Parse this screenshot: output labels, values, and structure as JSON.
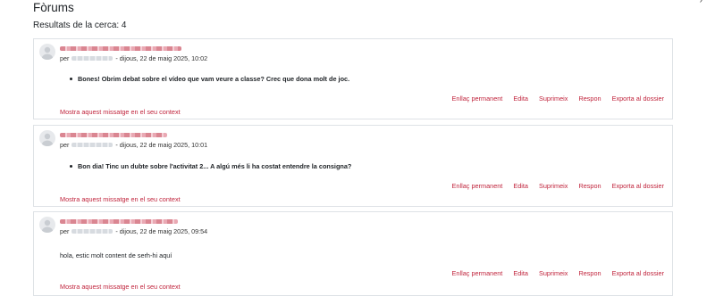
{
  "page": {
    "title": "Fòrums",
    "results_label": "Resultats de la cerca: 4",
    "corner_glyph": "›"
  },
  "colors": {
    "link": "#c0243c",
    "border": "#dee2e6",
    "text": "#1d2125"
  },
  "posts": [
    {
      "subject": "",
      "author": "",
      "by_prefix": "per",
      "date": "- dijous, 22 de maig 2025, 10:02",
      "message": "Bones! Obrim debat sobre el vídeo que vam veure a classe? Crec que dona molt de joc.",
      "message_is_bullet": true,
      "commands": [
        "Enllaç permanent",
        "Edita",
        "Suprimeix",
        "Respon",
        "Exporta al dossier"
      ],
      "context_link": "Mostra aquest missatge en el seu context"
    },
    {
      "subject": "",
      "author": "",
      "by_prefix": "per",
      "date": "- dijous, 22 de maig 2025, 10:01",
      "message": "Bon dia! Tinc un dubte sobre l'activitat 2... A algú més li ha costat entendre la consigna?",
      "message_is_bullet": true,
      "commands": [
        "Enllaç permanent",
        "Edita",
        "Suprimeix",
        "Respon",
        "Exporta al dossier"
      ],
      "context_link": "Mostra aquest missatge en el seu context"
    },
    {
      "subject": "",
      "author": "",
      "by_prefix": "per",
      "date": "- dijous, 22 de maig 2025, 09:54",
      "message": "hola, estic molt content de serh-hi aquí",
      "message_is_bullet": false,
      "commands": [
        "Enllaç permanent",
        "Edita",
        "Suprimeix",
        "Respon",
        "Exporta al dossier"
      ],
      "context_link": "Mostra aquest missatge en el seu context"
    }
  ]
}
